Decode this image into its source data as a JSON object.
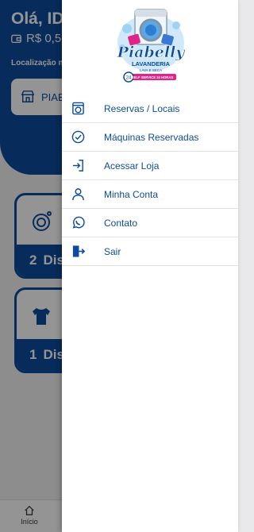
{
  "app": {
    "greeting": "Olá, ID",
    "balance": "R$ 0,5",
    "location_label": "Localização n",
    "location_value": "PIAB",
    "machines": [
      {
        "count": "2",
        "label": "Dis"
      },
      {
        "count": "1",
        "label": "Dis"
      }
    ],
    "nav_home_label": "Início"
  },
  "logo": {
    "name": "Piabelly",
    "subtitle": "LAVANDERIA",
    "tagline": "LAVA E SECA",
    "ribbon": "SELF SERVICE 24 HORAS"
  },
  "drawer": {
    "items": [
      {
        "label": "Reservas / Locais",
        "icon": "washing-machine-icon"
      },
      {
        "label": "Máquinas Reservadas",
        "icon": "check-circle-icon"
      },
      {
        "label": "Acessar Loja",
        "icon": "login-icon"
      },
      {
        "label": "Minha Conta",
        "icon": "user-icon"
      },
      {
        "label": "Contato",
        "icon": "whatsapp-icon"
      },
      {
        "label": "Sair",
        "icon": "logout-icon"
      }
    ]
  },
  "colors": {
    "brand": "#0d4b9b",
    "accent_pink": "#e0258a"
  }
}
